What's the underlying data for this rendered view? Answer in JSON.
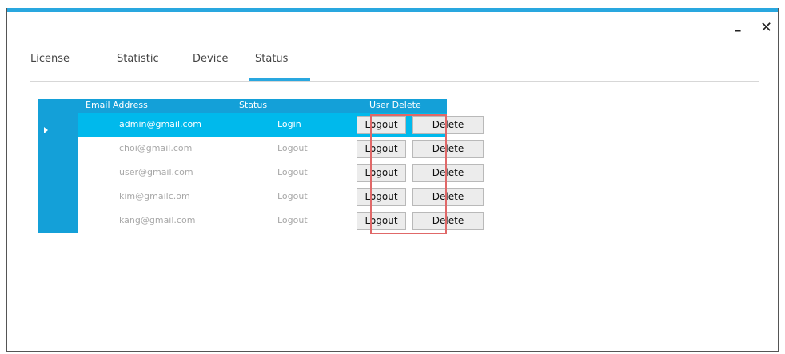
{
  "window": {
    "minimize": "–",
    "close": "✕"
  },
  "tabs": [
    {
      "label": "License"
    },
    {
      "label": "Statistic"
    },
    {
      "label": "Device"
    },
    {
      "label": "Status",
      "active": true
    }
  ],
  "table": {
    "columns": {
      "email": "Email Address",
      "status": "Status",
      "delete": "User Delete"
    },
    "rows": [
      {
        "email": "admin@gmail.com",
        "status": "Login",
        "logout": "Logout",
        "delete": "Delete",
        "selected": true
      },
      {
        "email": "choi@gmail.com",
        "status": "Logout",
        "logout": "Logout",
        "delete": "Delete"
      },
      {
        "email": "user@gmail.com",
        "status": "Logout",
        "logout": "Logout",
        "delete": "Delete"
      },
      {
        "email": "kim@gmailc.om",
        "status": "Logout",
        "logout": "Logout",
        "delete": "Delete"
      },
      {
        "email": "kang@gmail.com",
        "status": "Logout",
        "logout": "Logout",
        "delete": "Delete"
      }
    ]
  },
  "colors": {
    "accent": "#29a7df",
    "header": "#14a0d8",
    "selected_row": "#00b9ec",
    "highlight": "#e06868"
  },
  "icons": {
    "row_marker": "triangle-right-icon"
  }
}
